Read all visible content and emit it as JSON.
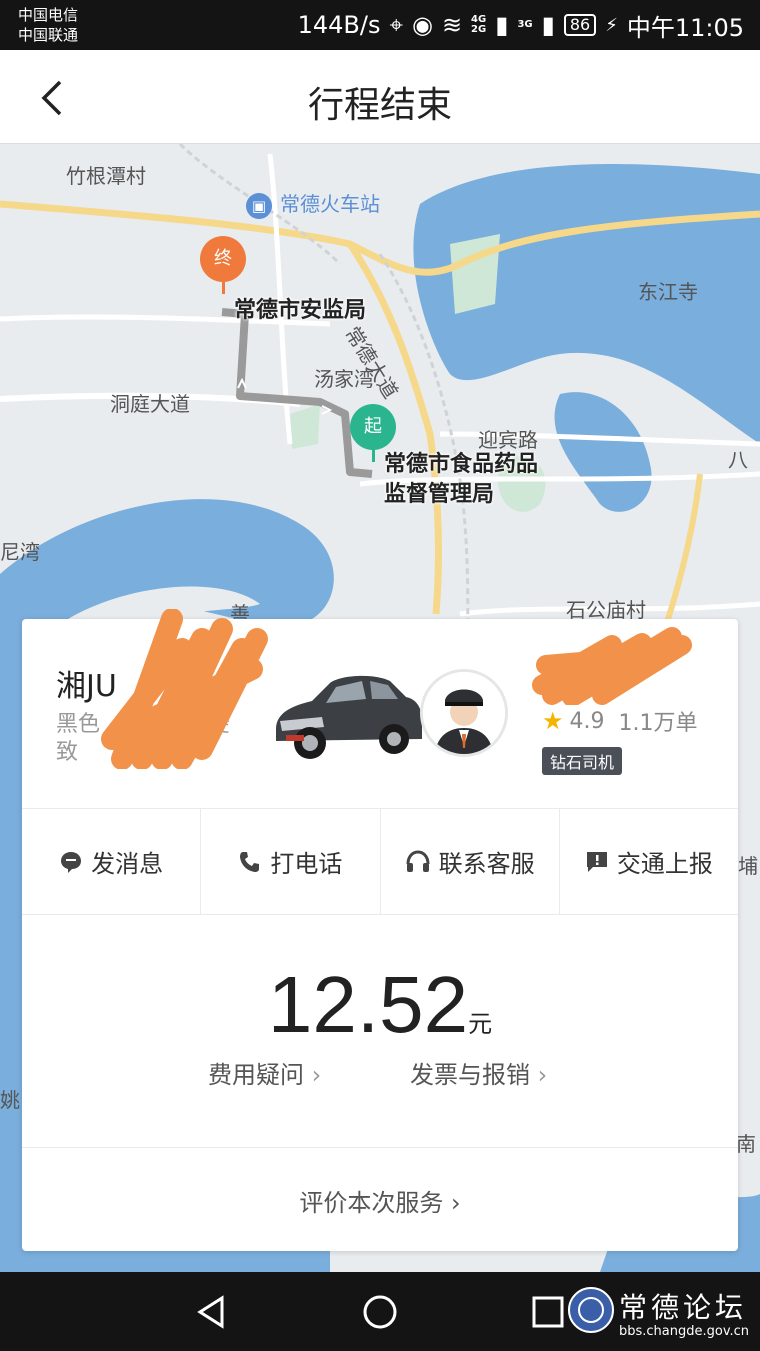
{
  "status": {
    "carrier1": "中国电信",
    "carrier2": "中国联通",
    "speed": "144B/s",
    "net1": "4G",
    "net1b": "2G",
    "net2": "3G",
    "battery": "86",
    "time": "中午11:05"
  },
  "header": {
    "title": "行程结束"
  },
  "map": {
    "labels": {
      "village1": "竹根潭村",
      "station": "常德火车站",
      "temple": "东江寺",
      "dongting": "洞庭大道",
      "tangjiawan": "汤家湾",
      "changde_ave": "常德大道",
      "yingbin": "迎宾路",
      "shigongmiao": "石公庙村",
      "niwan": "尼湾",
      "ba": "八",
      "shan": "善",
      "pu": "埔",
      "yao": "姚",
      "nan": "南"
    },
    "end_pin": "终",
    "start_pin": "起",
    "end_poi": "常德市安监局",
    "start_poi_line1": "常德市食品药品",
    "start_poi_line2": "监督管理局"
  },
  "driver": {
    "plate": "湘JU",
    "car_line1": "黑色",
    "car_line1_end": "菱",
    "car_line2": "致",
    "rating": "4.9",
    "orders": "1.1万单",
    "badge": "钻石司机"
  },
  "actions": [
    {
      "label": "发消息",
      "icon": "message-icon"
    },
    {
      "label": "打电话",
      "icon": "phone-icon"
    },
    {
      "label": "联系客服",
      "icon": "headset-icon"
    },
    {
      "label": "交通上报",
      "icon": "report-icon"
    }
  ],
  "fare": {
    "amount": "12.52",
    "unit": "元",
    "question": "费用疑问",
    "invoice": "发票与报销",
    "chevron": "›"
  },
  "rate_service": "评价本次服务 ›",
  "watermark": {
    "title": "常德论坛",
    "url": "bbs.changde.gov.cn"
  },
  "colors": {
    "start": "#2bb58f",
    "end": "#f07a3c",
    "route": "#9a9a9a",
    "water": "#7aaedc"
  }
}
